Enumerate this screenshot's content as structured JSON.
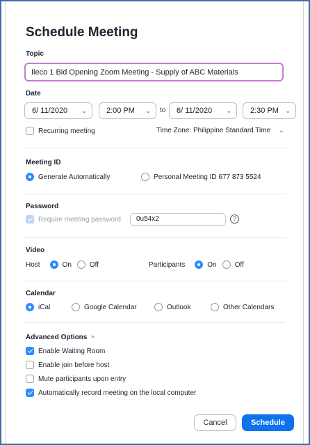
{
  "dialog": {
    "title": "Schedule Meeting"
  },
  "topic": {
    "label": "Topic",
    "value": "Ileco 1 Bid Opening Zoom Meeting - Supply of ABC Materials"
  },
  "date": {
    "label": "Date",
    "start_date": "6/ 11/2020",
    "start_time": "2:00 PM",
    "to_label": "to",
    "end_date": "6/ 11/2020",
    "end_time": "2:30 PM",
    "recurring_label": "Recurring meeting",
    "recurring_checked": false,
    "timezone_label": "Time Zone: Philippine Standard Time"
  },
  "meeting_id": {
    "label": "Meeting ID",
    "option_generate": "Generate Automatically",
    "option_personal": "Personal Meeting ID 677 873 5524",
    "selected": "generate"
  },
  "password": {
    "label": "Password",
    "require_label": "Require meeting password",
    "value": "0u54x2",
    "help_glyph": "?"
  },
  "video": {
    "label": "Video",
    "host_label": "Host",
    "participants_label": "Participants",
    "on_label": "On",
    "off_label": "Off",
    "host_selected": "on",
    "participants_selected": "on"
  },
  "calendar": {
    "label": "Calendar",
    "options": [
      "iCal",
      "Google Calendar",
      "Outlook",
      "Other Calendars"
    ],
    "selected": "iCal"
  },
  "advanced": {
    "label": "Advanced Options",
    "toggle_glyph": "^",
    "options": [
      {
        "label": "Enable Waiting Room",
        "checked": true
      },
      {
        "label": "Enable join before host",
        "checked": false
      },
      {
        "label": "Mute participants upon entry",
        "checked": false
      },
      {
        "label": "Automatically record meeting on the local computer",
        "checked": true
      }
    ]
  },
  "footer": {
    "cancel_label": "Cancel",
    "schedule_label": "Schedule"
  },
  "colors": {
    "accent": "#2d8cff",
    "primary_button": "#0e72ed",
    "focus_border": "#c47bd3"
  },
  "icons": {
    "chevron": "chevron-down-icon",
    "help": "question-circle-icon",
    "check": "checkmark-icon"
  }
}
